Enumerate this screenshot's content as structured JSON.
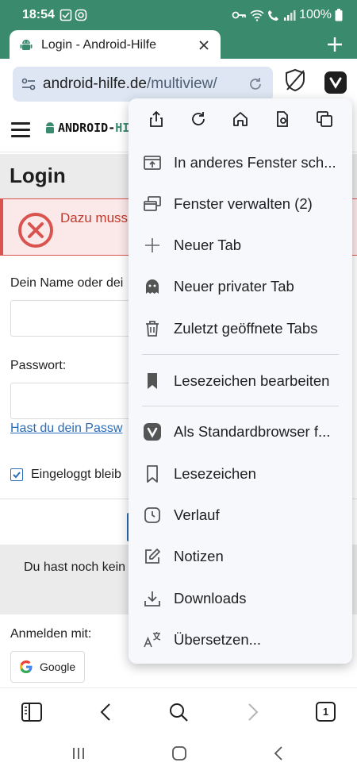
{
  "status_bar": {
    "time": "18:54",
    "battery": "100%"
  },
  "tab": {
    "title": "Login - Android-Hilfe"
  },
  "address_bar": {
    "host": "android-hilfe.de",
    "path": "/multiview/"
  },
  "site": {
    "logo_text_a": "ANDROID-",
    "logo_text_b": "HILF",
    "page_heading": "Login",
    "error_message": "Dazu muss",
    "name_label": "Dein Name oder dei",
    "password_label": "Passwort:",
    "forgot_link": "Hast du dein Passw",
    "stay_logged_in": "Eingeloggt bleib",
    "no_account_text": "Du hast noch kein",
    "sign_in_with": "Anmelden mit:",
    "google_label": "Google"
  },
  "menu": {
    "top_icons": [
      "share-icon",
      "reload-icon",
      "home-icon",
      "page-capture-icon",
      "windows-icon"
    ],
    "items": [
      {
        "label": "In anderes Fenster sch...",
        "icon": "move-window-icon"
      },
      {
        "label": "Fenster verwalten (2)",
        "icon": "manage-windows-icon"
      },
      {
        "label": "Neuer Tab",
        "icon": "plus-icon"
      },
      {
        "label": "Neuer privater Tab",
        "icon": "ghost-icon"
      },
      {
        "label": "Zuletzt geöffnete Tabs",
        "icon": "trash-icon"
      },
      {
        "label": "Lesezeichen bearbeiten",
        "icon": "bookmark-filled-icon"
      },
      {
        "label": "Als Standardbrowser f...",
        "icon": "vivaldi-icon"
      },
      {
        "label": "Lesezeichen",
        "icon": "bookmark-icon"
      },
      {
        "label": "Verlauf",
        "icon": "history-icon"
      },
      {
        "label": "Notizen",
        "icon": "notes-icon"
      },
      {
        "label": "Downloads",
        "icon": "download-icon"
      },
      {
        "label": "Übersetzen...",
        "icon": "translate-icon"
      }
    ]
  },
  "toolbar": {
    "tab_count": "1"
  },
  "colors": {
    "accent": "#3a8a6e",
    "url_bg": "#dde6f2",
    "error": "#d9534f",
    "link": "#2a6cb6",
    "menu_bg": "#f6f8fc"
  }
}
